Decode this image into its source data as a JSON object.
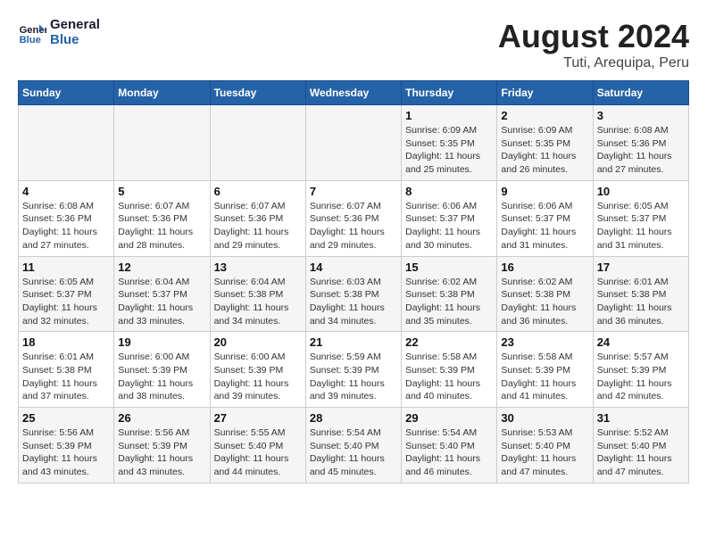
{
  "logo": {
    "text_general": "General",
    "text_blue": "Blue"
  },
  "title": "August 2024",
  "subtitle": "Tuti, Arequipa, Peru",
  "weekdays": [
    "Sunday",
    "Monday",
    "Tuesday",
    "Wednesday",
    "Thursday",
    "Friday",
    "Saturday"
  ],
  "weeks": [
    [
      {
        "day": "",
        "info": ""
      },
      {
        "day": "",
        "info": ""
      },
      {
        "day": "",
        "info": ""
      },
      {
        "day": "",
        "info": ""
      },
      {
        "day": "1",
        "info": "Sunrise: 6:09 AM\nSunset: 5:35 PM\nDaylight: 11 hours\nand 25 minutes."
      },
      {
        "day": "2",
        "info": "Sunrise: 6:09 AM\nSunset: 5:35 PM\nDaylight: 11 hours\nand 26 minutes."
      },
      {
        "day": "3",
        "info": "Sunrise: 6:08 AM\nSunset: 5:36 PM\nDaylight: 11 hours\nand 27 minutes."
      }
    ],
    [
      {
        "day": "4",
        "info": "Sunrise: 6:08 AM\nSunset: 5:36 PM\nDaylight: 11 hours\nand 27 minutes."
      },
      {
        "day": "5",
        "info": "Sunrise: 6:07 AM\nSunset: 5:36 PM\nDaylight: 11 hours\nand 28 minutes."
      },
      {
        "day": "6",
        "info": "Sunrise: 6:07 AM\nSunset: 5:36 PM\nDaylight: 11 hours\nand 29 minutes."
      },
      {
        "day": "7",
        "info": "Sunrise: 6:07 AM\nSunset: 5:36 PM\nDaylight: 11 hours\nand 29 minutes."
      },
      {
        "day": "8",
        "info": "Sunrise: 6:06 AM\nSunset: 5:37 PM\nDaylight: 11 hours\nand 30 minutes."
      },
      {
        "day": "9",
        "info": "Sunrise: 6:06 AM\nSunset: 5:37 PM\nDaylight: 11 hours\nand 31 minutes."
      },
      {
        "day": "10",
        "info": "Sunrise: 6:05 AM\nSunset: 5:37 PM\nDaylight: 11 hours\nand 31 minutes."
      }
    ],
    [
      {
        "day": "11",
        "info": "Sunrise: 6:05 AM\nSunset: 5:37 PM\nDaylight: 11 hours\nand 32 minutes."
      },
      {
        "day": "12",
        "info": "Sunrise: 6:04 AM\nSunset: 5:37 PM\nDaylight: 11 hours\nand 33 minutes."
      },
      {
        "day": "13",
        "info": "Sunrise: 6:04 AM\nSunset: 5:38 PM\nDaylight: 11 hours\nand 34 minutes."
      },
      {
        "day": "14",
        "info": "Sunrise: 6:03 AM\nSunset: 5:38 PM\nDaylight: 11 hours\nand 34 minutes."
      },
      {
        "day": "15",
        "info": "Sunrise: 6:02 AM\nSunset: 5:38 PM\nDaylight: 11 hours\nand 35 minutes."
      },
      {
        "day": "16",
        "info": "Sunrise: 6:02 AM\nSunset: 5:38 PM\nDaylight: 11 hours\nand 36 minutes."
      },
      {
        "day": "17",
        "info": "Sunrise: 6:01 AM\nSunset: 5:38 PM\nDaylight: 11 hours\nand 36 minutes."
      }
    ],
    [
      {
        "day": "18",
        "info": "Sunrise: 6:01 AM\nSunset: 5:38 PM\nDaylight: 11 hours\nand 37 minutes."
      },
      {
        "day": "19",
        "info": "Sunrise: 6:00 AM\nSunset: 5:39 PM\nDaylight: 11 hours\nand 38 minutes."
      },
      {
        "day": "20",
        "info": "Sunrise: 6:00 AM\nSunset: 5:39 PM\nDaylight: 11 hours\nand 39 minutes."
      },
      {
        "day": "21",
        "info": "Sunrise: 5:59 AM\nSunset: 5:39 PM\nDaylight: 11 hours\nand 39 minutes."
      },
      {
        "day": "22",
        "info": "Sunrise: 5:58 AM\nSunset: 5:39 PM\nDaylight: 11 hours\nand 40 minutes."
      },
      {
        "day": "23",
        "info": "Sunrise: 5:58 AM\nSunset: 5:39 PM\nDaylight: 11 hours\nand 41 minutes."
      },
      {
        "day": "24",
        "info": "Sunrise: 5:57 AM\nSunset: 5:39 PM\nDaylight: 11 hours\nand 42 minutes."
      }
    ],
    [
      {
        "day": "25",
        "info": "Sunrise: 5:56 AM\nSunset: 5:39 PM\nDaylight: 11 hours\nand 43 minutes."
      },
      {
        "day": "26",
        "info": "Sunrise: 5:56 AM\nSunset: 5:39 PM\nDaylight: 11 hours\nand 43 minutes."
      },
      {
        "day": "27",
        "info": "Sunrise: 5:55 AM\nSunset: 5:40 PM\nDaylight: 11 hours\nand 44 minutes."
      },
      {
        "day": "28",
        "info": "Sunrise: 5:54 AM\nSunset: 5:40 PM\nDaylight: 11 hours\nand 45 minutes."
      },
      {
        "day": "29",
        "info": "Sunrise: 5:54 AM\nSunset: 5:40 PM\nDaylight: 11 hours\nand 46 minutes."
      },
      {
        "day": "30",
        "info": "Sunrise: 5:53 AM\nSunset: 5:40 PM\nDaylight: 11 hours\nand 47 minutes."
      },
      {
        "day": "31",
        "info": "Sunrise: 5:52 AM\nSunset: 5:40 PM\nDaylight: 11 hours\nand 47 minutes."
      }
    ]
  ]
}
